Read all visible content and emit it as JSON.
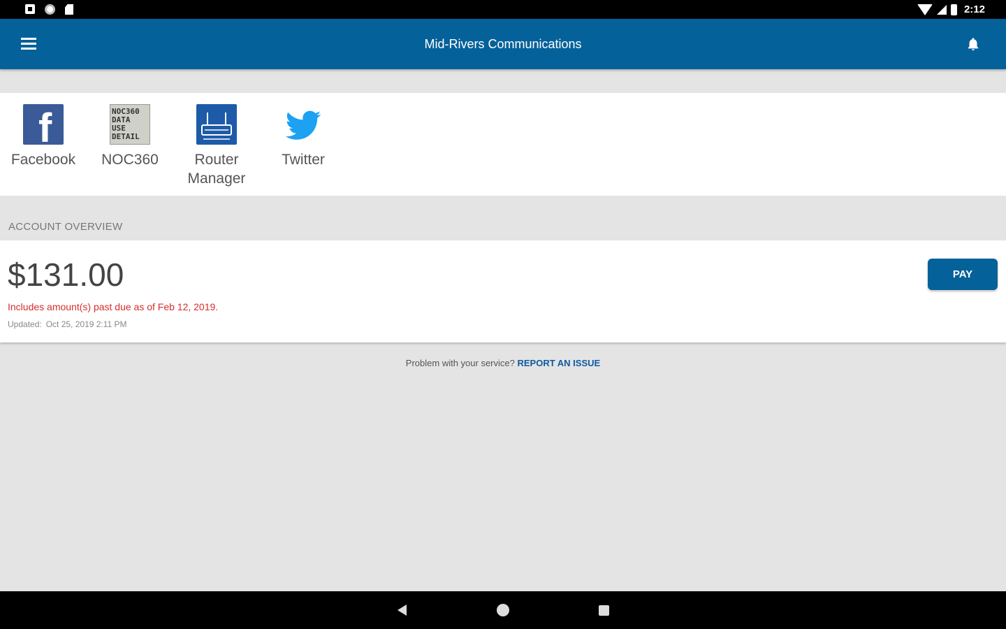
{
  "status_bar": {
    "time": "2:12",
    "left_icons": [
      "notification-icon",
      "sync-icon",
      "sd-card-icon"
    ],
    "right_icons": [
      "wifi-icon",
      "cell-signal-icon",
      "battery-icon"
    ]
  },
  "app_bar": {
    "title": "Mid-Rivers Communications",
    "menu_icon": "hamburger-menu-icon",
    "bell_icon": "bell-icon"
  },
  "shortcuts": [
    {
      "label": "Facebook",
      "icon": "facebook-icon"
    },
    {
      "label": "NOC360",
      "icon": "noc360-icon",
      "icon_text": [
        "NOC360",
        "DATA",
        "USE",
        "DETAIL"
      ]
    },
    {
      "label": "Router Manager",
      "label_line1": "Router",
      "label_line2": "Manager",
      "icon": "router-icon"
    },
    {
      "label": "Twitter",
      "icon": "twitter-icon"
    }
  ],
  "account_overview": {
    "header": "ACCOUNT OVERVIEW",
    "balance": "$131.00",
    "past_due_notice": "Includes amount(s) past due as of Feb 12, 2019.",
    "updated_label": "Updated:",
    "updated_value": "Oct 25, 2019 2:11 PM",
    "pay_label": "PAY"
  },
  "report": {
    "prompt": "Problem with your service?",
    "link": "REPORT AN ISSUE"
  },
  "colors": {
    "brand": "#056199",
    "past_due": "#d62d2d",
    "facebook": "#3a5a98",
    "twitter": "#1da1f2"
  }
}
